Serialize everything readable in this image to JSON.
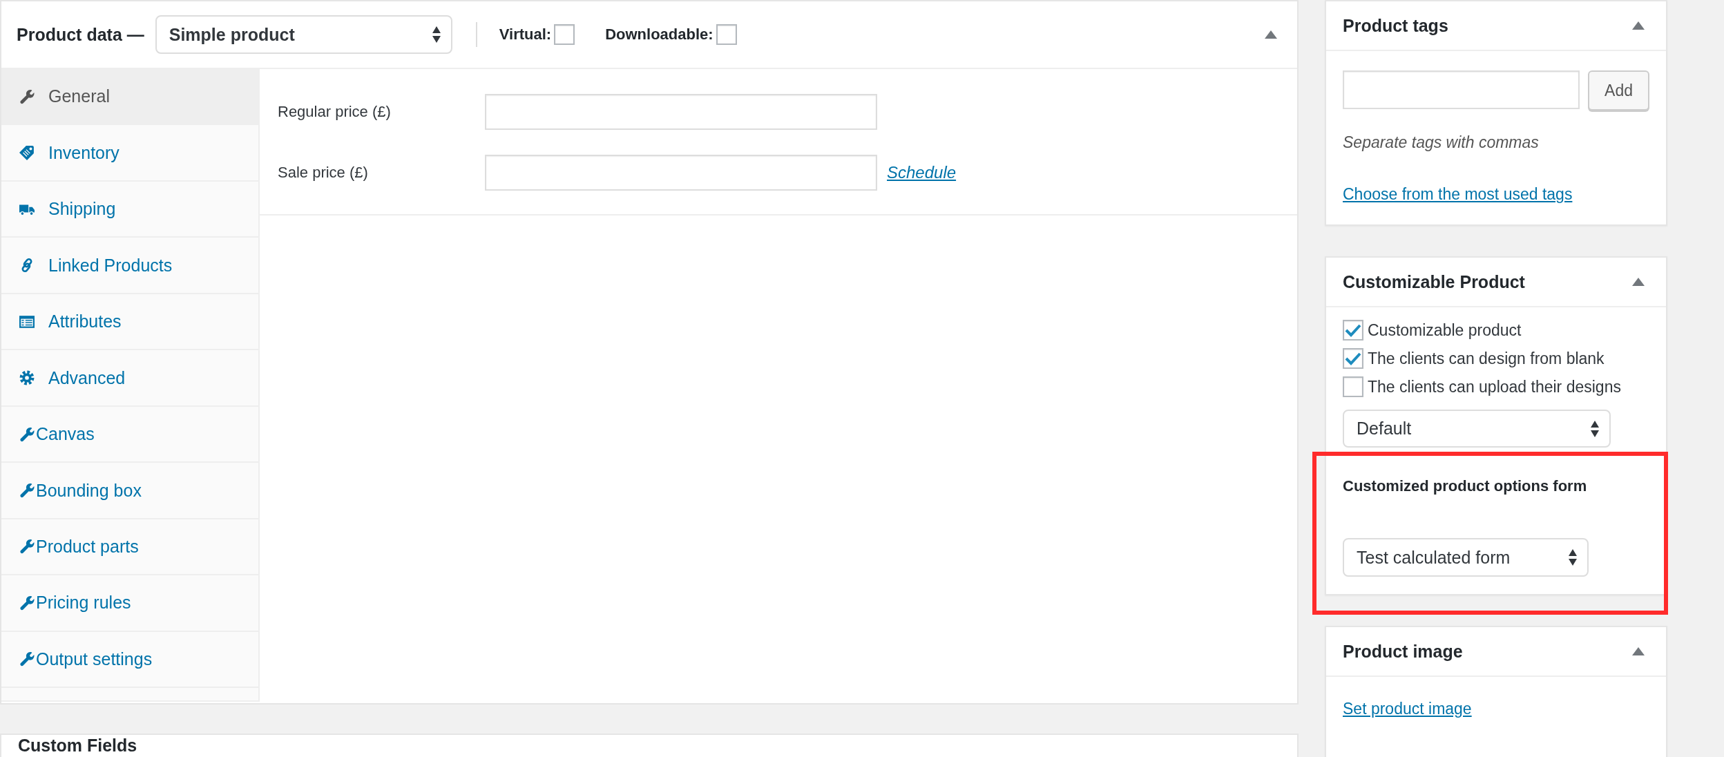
{
  "product_data": {
    "title": "Product data —",
    "product_type": "Simple product",
    "expanded": true,
    "options": [
      {
        "label": "Virtual:",
        "checked": false
      },
      {
        "label": "Downloadable:",
        "checked": false
      }
    ],
    "tabs": [
      {
        "label": "General",
        "kind": "core",
        "selected": true
      },
      {
        "label": "Inventory",
        "kind": "core",
        "selected": false
      },
      {
        "label": "Shipping",
        "kind": "core",
        "selected": false
      },
      {
        "label": "Linked Products",
        "kind": "core",
        "selected": false
      },
      {
        "label": "Attributes",
        "kind": "core",
        "selected": false
      },
      {
        "label": "Advanced",
        "kind": "core",
        "selected": false
      },
      {
        "label": "Canvas",
        "kind": "custom",
        "selected": false
      },
      {
        "label": "Bounding box",
        "kind": "custom",
        "selected": false
      },
      {
        "label": "Product parts",
        "kind": "custom",
        "selected": false
      },
      {
        "label": "Pricing rules",
        "kind": "custom",
        "selected": false
      },
      {
        "label": "Output settings",
        "kind": "custom",
        "selected": false
      }
    ],
    "fields": [
      {
        "label": "Regular price (£)"
      },
      {
        "label": "Sale price (£)",
        "link": "Schedule"
      }
    ]
  },
  "sidebar": [
    {
      "kind": "tags",
      "title": "Product tags",
      "expanded": true,
      "button": "Add",
      "hint": "Separate tags with commas",
      "link": "Choose from the most used tags"
    },
    {
      "kind": "customizable",
      "title": "Customizable Product",
      "expanded": true,
      "highlighted": true,
      "checkboxes": [
        {
          "label": "Customizable product",
          "checked": true
        },
        {
          "label": "The clients can design from blank",
          "checked": true
        },
        {
          "label": "The clients can upload their designs",
          "checked": false
        }
      ],
      "template_select": "Default",
      "form_label": "Customized product options form",
      "form_select": "Test calculated form"
    },
    {
      "kind": "image",
      "title": "Product image",
      "expanded": true,
      "link": "Set product image"
    }
  ],
  "custom_fields": {
    "title": "Custom Fields"
  }
}
